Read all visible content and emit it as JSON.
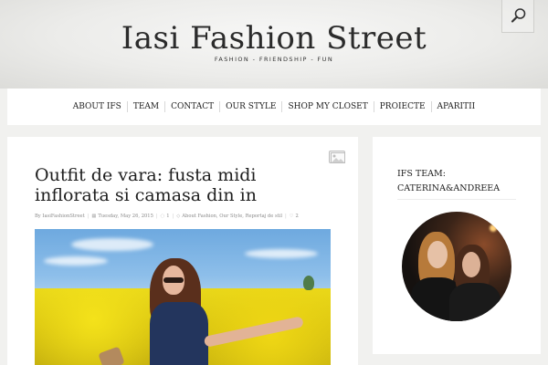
{
  "header": {
    "site_title": "Iasi Fashion Street",
    "tagline": "FASHION - FRIENDSHIP - FUN",
    "search_icon": "search-icon"
  },
  "nav": {
    "items": [
      {
        "label": "ABOUT IFS"
      },
      {
        "label": "TEAM"
      },
      {
        "label": "CONTACT"
      },
      {
        "label": "OUR STYLE"
      },
      {
        "label": "SHOP MY CLOSET"
      },
      {
        "label": "PROIECTE"
      },
      {
        "label": "APARITII"
      }
    ]
  },
  "post": {
    "format_icon": "image-format-icon",
    "title": "Outfit de vara: fusta midi inflorata si camasa din in",
    "meta": {
      "author": "By IasiFashionStreet",
      "date": "Tuesday, May 26, 2015",
      "comments": "1",
      "categories": "About Fashion, Our Style, Reportaj de stil",
      "likes": "2"
    }
  },
  "sidebar": {
    "widget_title": "IFS TEAM: CATERINA&ANDREEA"
  },
  "colors": {
    "background": "#f1f1ef",
    "panel": "#ffffff",
    "title_text": "#1e1e1e",
    "meta_text": "#8a8a8a"
  }
}
